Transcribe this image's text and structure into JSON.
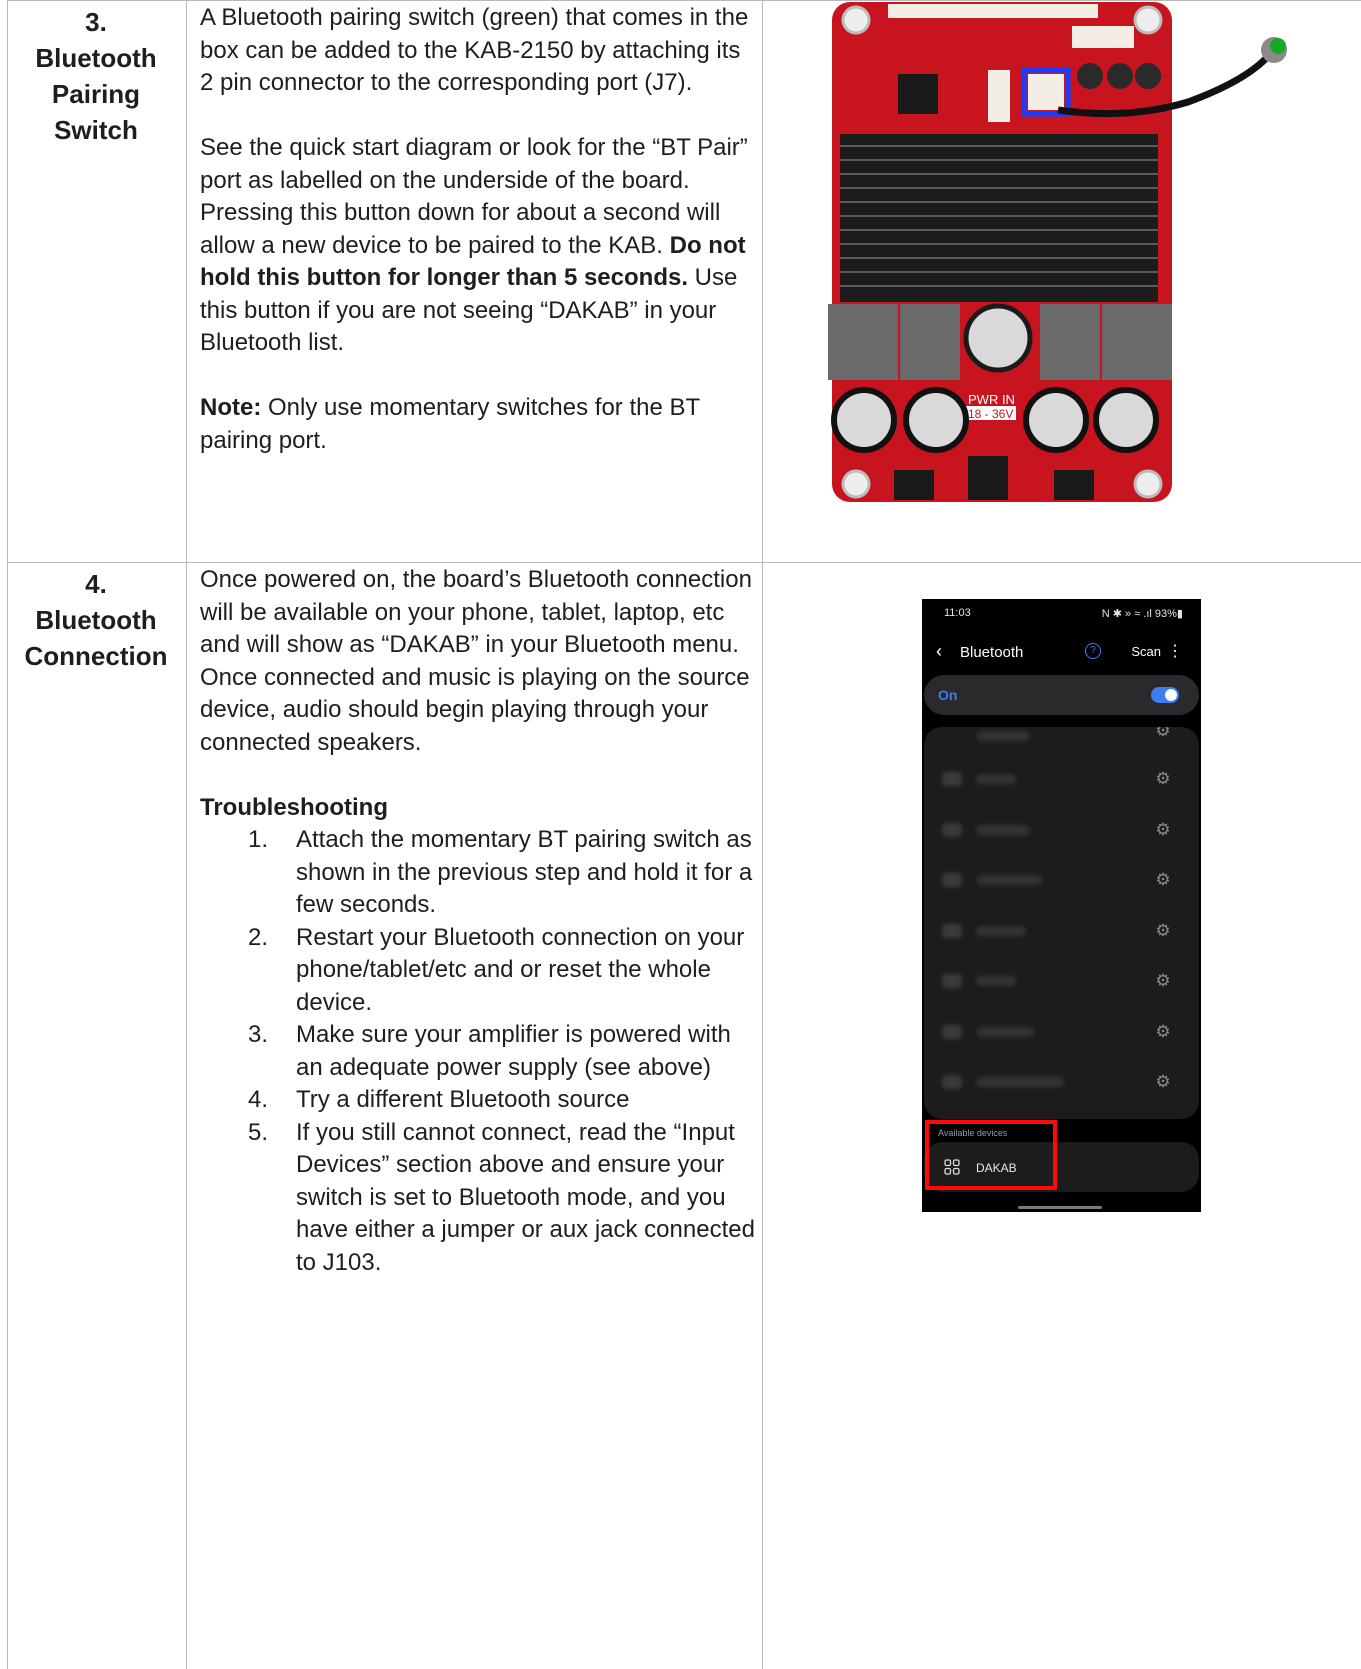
{
  "rows": [
    {
      "step_number": "3.",
      "title_lines": [
        "Bluetooth",
        "Pairing",
        "Switch"
      ],
      "text": {
        "p1": "A Bluetooth pairing switch (green) that comes in the box can be added to the KAB-2150 by attaching its 2 pin connector to the corresponding port (J7).",
        "p2": "See the quick start diagram or look for the “BT Pair” port as labelled on the underside of the board.",
        "p3_a": "Pressing this button down for about a second will allow a new device to be paired to the KAB. ",
        "p3_bold": "Do not hold this button for longer than 5 seconds.",
        "p3_b": " Use this button if you are not seeing “DAKAB” in your Bluetooth list.",
        "note_label": "Note:",
        "note_text": " Only use momentary switches for the BT pairing port."
      },
      "image": {
        "type": "product-photo",
        "labels": {
          "pwr_in": "PWR IN",
          "voltage": "18 - 36V"
        }
      }
    },
    {
      "step_number": "4.",
      "title_lines": [
        "Bluetooth",
        "Connection"
      ],
      "text": {
        "p1": "Once powered on, the board’s Bluetooth connection will be available on your phone, tablet, laptop, etc and will show as “DAKAB” in your Bluetooth menu. Once connected and music is playing on the source device, audio should begin playing through your connected speakers.",
        "troubleshooting_heading": "Troubleshooting",
        "troubleshooting_steps": [
          {
            "num": "1.",
            "text": "Attach the momentary BT pairing switch as shown in the previous step and hold it for a few seconds."
          },
          {
            "num": "2.",
            "text": "Restart your Bluetooth connection on your phone/tablet/etc and or reset the whole device."
          },
          {
            "num": "3.",
            "text": "Make sure your amplifier is powered with an adequate power supply (see above)"
          },
          {
            "num": "4.",
            "text": "Try a different Bluetooth source"
          },
          {
            "num": "5.",
            "text": "If you still cannot connect, read the “Input Devices” section above and ensure your switch is set to Bluetooth mode, and you have either a jumper or aux jack connected to J103."
          }
        ]
      },
      "phone": {
        "status_time": "11:03",
        "status_icons": "N ✱ » ≈ .ıl 93%▮",
        "back_icon": "chevron-left-icon",
        "title": "Bluetooth",
        "help_icon": "help-icon",
        "help_glyph": "?",
        "scan_label": "Scan",
        "more_icon": "more-vert-icon",
        "toggle_label": "On",
        "toggle_on": true,
        "accent_color": "#3d7cf1",
        "paired_devices_blurred": 8,
        "available_label": "Available devices",
        "available_device": "DAKAB",
        "highlight_color": "#ff0a0a"
      }
    }
  ]
}
